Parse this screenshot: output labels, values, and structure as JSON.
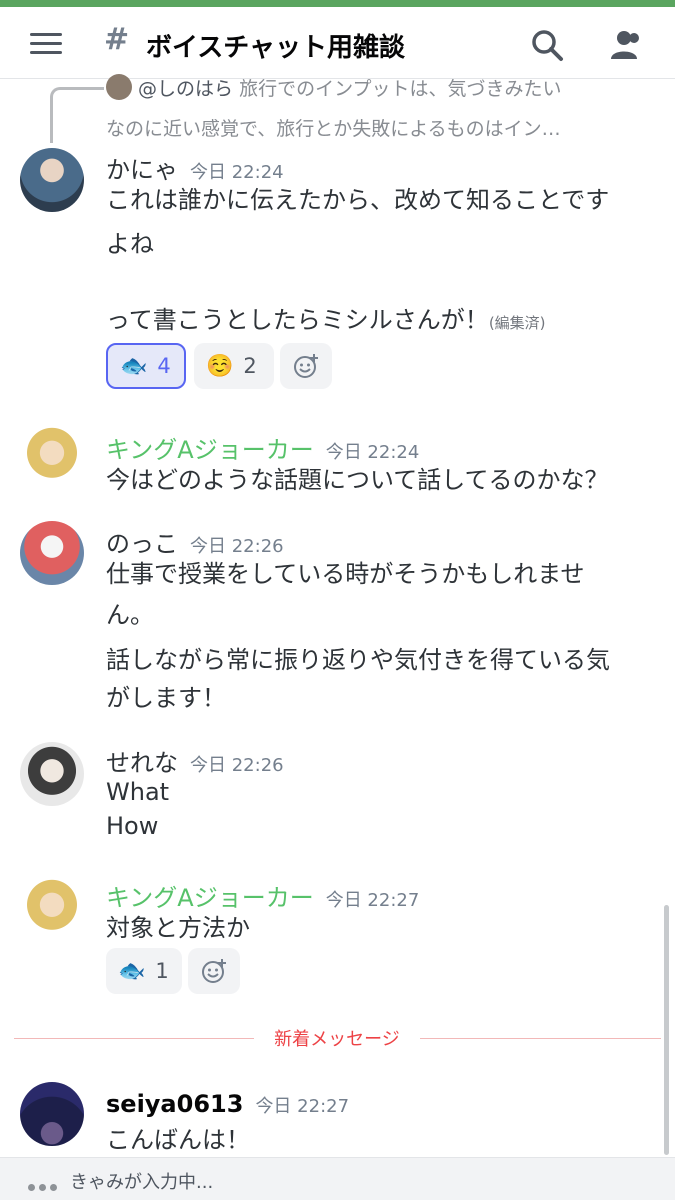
{
  "header": {
    "channel_name": "ボイスチャット用雑談"
  },
  "colors": {
    "accent": "#5865f2",
    "green_name": "#57c26a",
    "new_messages": "#ed4245"
  },
  "reply": {
    "mention": "@しのはら",
    "line1": "旅行でのインプットは、気づきみたい",
    "line2": "なのに近い感覚で、旅行とか失敗によるものはイン…"
  },
  "messages": [
    {
      "author": "かにゃ",
      "timestamp": "今日 22:24",
      "lines": [
        "これは誰かに伝えたから、改めて知ることです",
        "よね",
        "って書こうとしたらミシルさんが！"
      ],
      "edited": "(編集済)",
      "reactions": [
        {
          "emoji": "fish",
          "count": "4",
          "active": true
        },
        {
          "emoji": "relieved-face",
          "count": "2",
          "active": false
        }
      ]
    },
    {
      "author": "キングAジョーカー",
      "timestamp": "今日 22:24",
      "lines": [
        "今はどのような話題について話してるのかな？"
      ]
    },
    {
      "author": "のっこ",
      "timestamp": "今日 22:26",
      "lines": [
        "仕事で授業をしている時がそうかもしれませ",
        "ん。",
        "話しながら常に振り返りや気付きを得ている気",
        "がします！"
      ]
    },
    {
      "author": "せれな",
      "timestamp": "今日 22:26",
      "lines": [
        "What",
        "How"
      ]
    },
    {
      "author": "キングAジョーカー",
      "timestamp": "今日 22:27",
      "lines": [
        "対象と方法か"
      ],
      "reactions": [
        {
          "emoji": "fish",
          "count": "1",
          "active": false
        }
      ]
    },
    {
      "author": "seiya0613",
      "timestamp": "今日 22:27",
      "lines": [
        "こんばんは！"
      ]
    }
  ],
  "new_messages_label": "新着メッセージ",
  "typing": "きゃみが入力中..."
}
